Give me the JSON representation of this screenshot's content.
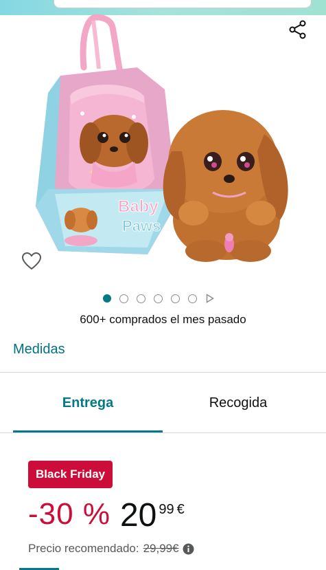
{
  "gallery": {
    "image_alt": "",
    "box_text_line1": "Baby",
    "box_text_line2": "Paws",
    "page_count": 6,
    "active_index": 0
  },
  "social_proof": {
    "bought_text": "600+ comprados el mes pasado"
  },
  "size_link": {
    "label": "Medidas"
  },
  "delivery_tabs": [
    {
      "label": "Entrega",
      "selected": true
    },
    {
      "label": "Recogida",
      "selected": false
    }
  ],
  "deal": {
    "badge": "Black Friday"
  },
  "price": {
    "discount": "-30 %",
    "whole": "20",
    "fraction": "99",
    "currency": "€"
  },
  "rrp": {
    "label": "Precio recomendado:",
    "value": "29,99€"
  },
  "colors": {
    "teal": "#047a86",
    "link": "#007185",
    "deal_red": "#cc0c39"
  },
  "icons": {
    "share": "share-icon",
    "wishlist": "heart-outline-icon",
    "info": "info-icon",
    "next": "play-triangle-icon"
  }
}
